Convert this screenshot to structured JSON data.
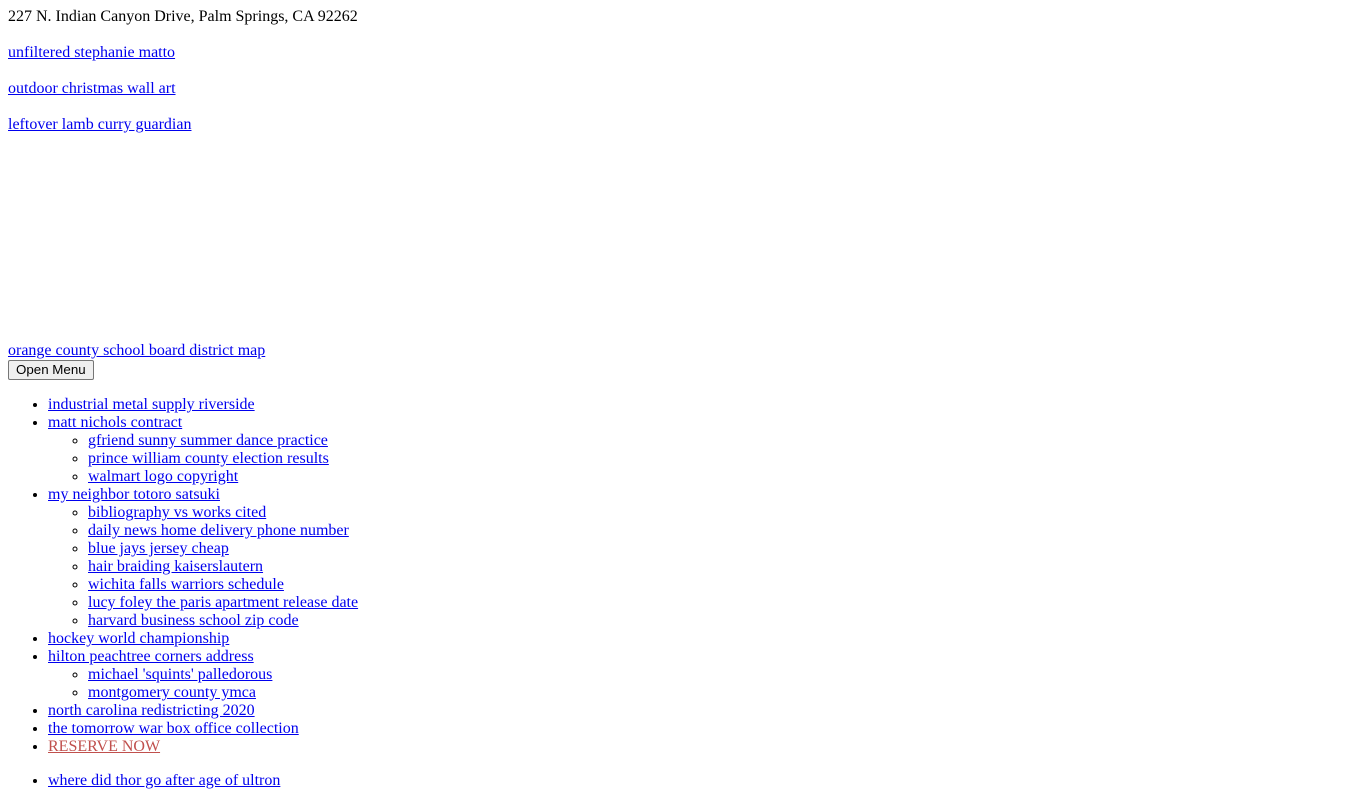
{
  "header": {
    "address": "227 N. Indian Canyon Drive, Palm Springs, CA 92262"
  },
  "colors": {
    "link": "#0000EE",
    "accent_link": "#C0504D",
    "text": "#000000",
    "background": "#FFFFFF",
    "button_background": "#EFEFEF",
    "button_border": "#767676"
  },
  "top_links": [
    {
      "label": "unfiltered stephanie matto"
    },
    {
      "label": "outdoor christmas wall art"
    },
    {
      "label": "leftover lamb curry guardian"
    }
  ],
  "brand": {
    "link_label": "orange county school board district map"
  },
  "menu_toggle": {
    "label": "Open Menu"
  },
  "primary_nav": [
    {
      "label": "industrial metal supply riverside",
      "children": []
    },
    {
      "label": "matt nichols contract",
      "children": [
        {
          "label": "gfriend sunny summer dance practice"
        },
        {
          "label": "prince william county election results"
        },
        {
          "label": "walmart logo copyright"
        }
      ]
    },
    {
      "label": "my neighbor totoro satsuki",
      "children": [
        {
          "label": "bibliography vs works cited"
        },
        {
          "label": "daily news home delivery phone number"
        },
        {
          "label": "blue jays jersey cheap"
        },
        {
          "label": "hair braiding kaiserslautern"
        },
        {
          "label": "wichita falls warriors schedule"
        },
        {
          "label": "lucy foley the paris apartment release date"
        },
        {
          "label": "harvard business school zip code"
        }
      ]
    },
    {
      "label": "hockey world championship",
      "children": []
    },
    {
      "label": "hilton peachtree corners address",
      "children": [
        {
          "label": "michael 'squints' palledorous"
        },
        {
          "label": "montgomery county ymca"
        }
      ]
    },
    {
      "label": "north carolina redistricting 2020",
      "children": []
    },
    {
      "label": "the tomorrow war box office collection",
      "children": []
    },
    {
      "label": "RESERVE NOW",
      "accent": true,
      "children": []
    }
  ],
  "secondary_nav": [
    {
      "label": "where did thor go after age of ultron"
    }
  ]
}
